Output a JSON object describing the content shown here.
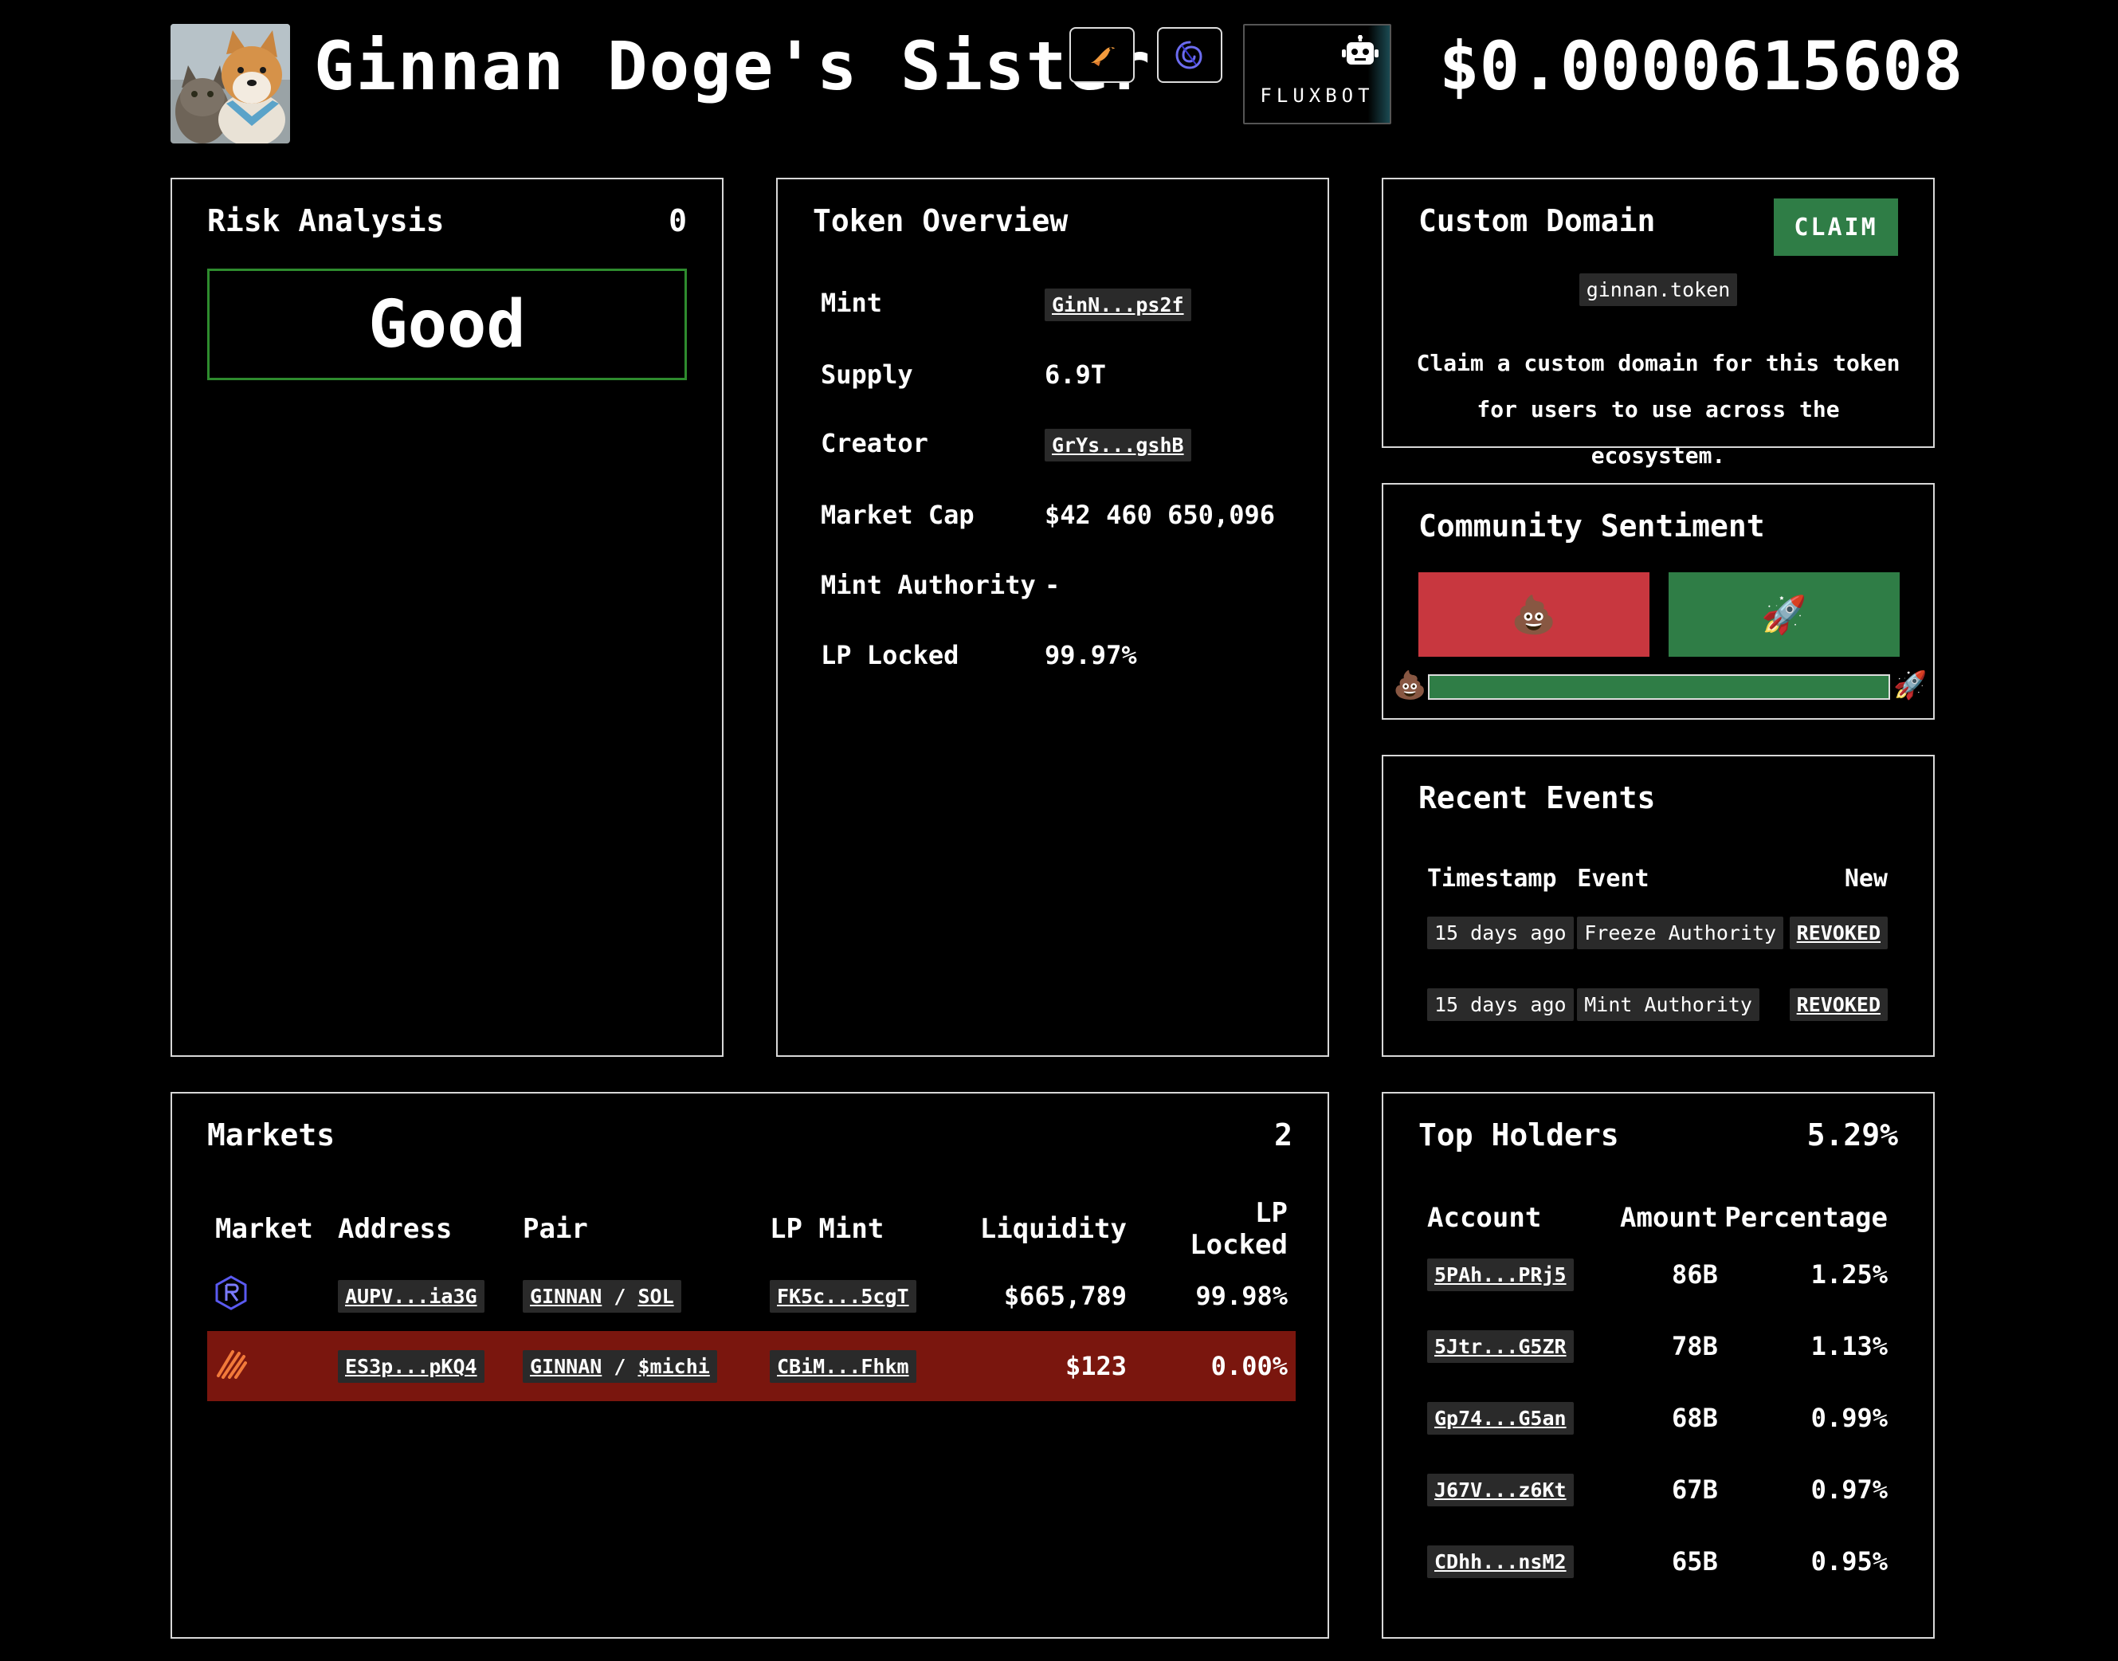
{
  "header": {
    "title": "Ginnan Doge's Sister",
    "price": "$0.0000615608",
    "fluxbot_label": "FLUXBOT"
  },
  "risk": {
    "title": "Risk Analysis",
    "score": "0",
    "rating": "Good"
  },
  "overview": {
    "title": "Token Overview",
    "rows": [
      {
        "label": "Mint",
        "value": "GinN...ps2f"
      },
      {
        "label": "Supply",
        "value": "6.9T"
      },
      {
        "label": "Creator",
        "value": "GrYs...gshB"
      },
      {
        "label": "Market Cap",
        "value": "$42 460 650,096"
      },
      {
        "label": "Mint Authority",
        "value": "-"
      },
      {
        "label": "LP Locked",
        "value": "99.97%"
      }
    ]
  },
  "domain": {
    "title": "Custom Domain",
    "claim_label": "CLAIM",
    "domain_name": "ginnan.token",
    "description": "Claim a custom domain for this token for users to use across the ecosystem."
  },
  "sentiment": {
    "title": "Community Sentiment",
    "bad_emoji": "💩",
    "good_emoji": "🚀",
    "positive_fraction": 1.0
  },
  "events": {
    "title": "Recent Events",
    "headers": [
      "Timestamp",
      "Event",
      "New"
    ],
    "rows": [
      {
        "time": "15 days ago",
        "event": "Freeze Authority",
        "new": "REVOKED"
      },
      {
        "time": "15 days ago",
        "event": "Mint Authority",
        "new": "REVOKED"
      }
    ]
  },
  "markets": {
    "title": "Markets",
    "count": "2",
    "headers": [
      "Market",
      "Address",
      "Pair",
      "LP Mint",
      "Liquidity",
      "LP Locked"
    ],
    "rows": [
      {
        "icon": "raydium-icon",
        "address": "AUPV...ia3G",
        "base": "GINNAN",
        "quote": "SOL",
        "lp_mint": "FK5c...5cgT",
        "liquidity": "$665,789",
        "lp_locked": "99.98%"
      },
      {
        "icon": "meteora-icon",
        "address": "ES3p...pKQ4",
        "base": "GINNAN",
        "quote": "$michi",
        "lp_mint": "CBiM...Fhkm",
        "liquidity": "$123",
        "lp_locked": "0.00%"
      }
    ]
  },
  "holders": {
    "title": "Top Holders",
    "total": "5.29%",
    "headers": [
      "Account",
      "Amount",
      "Percentage"
    ],
    "rows": [
      {
        "account": "5PAh...PRj5",
        "amount": "86B",
        "percentage": "1.25%"
      },
      {
        "account": "5Jtr...G5ZR",
        "amount": "78B",
        "percentage": "1.13%"
      },
      {
        "account": "Gp74...G5an",
        "amount": "68B",
        "percentage": "0.99%"
      },
      {
        "account": "J67V...z6Kt",
        "amount": "67B",
        "percentage": "0.97%"
      },
      {
        "account": "CDhh...nsM2",
        "amount": "65B",
        "percentage": "0.95%"
      }
    ]
  },
  "colors": {
    "good": "#2e8b2e",
    "claim": "#2f7d46",
    "bad_vote": "#c8373f",
    "flagged_row": "#7a160e"
  }
}
